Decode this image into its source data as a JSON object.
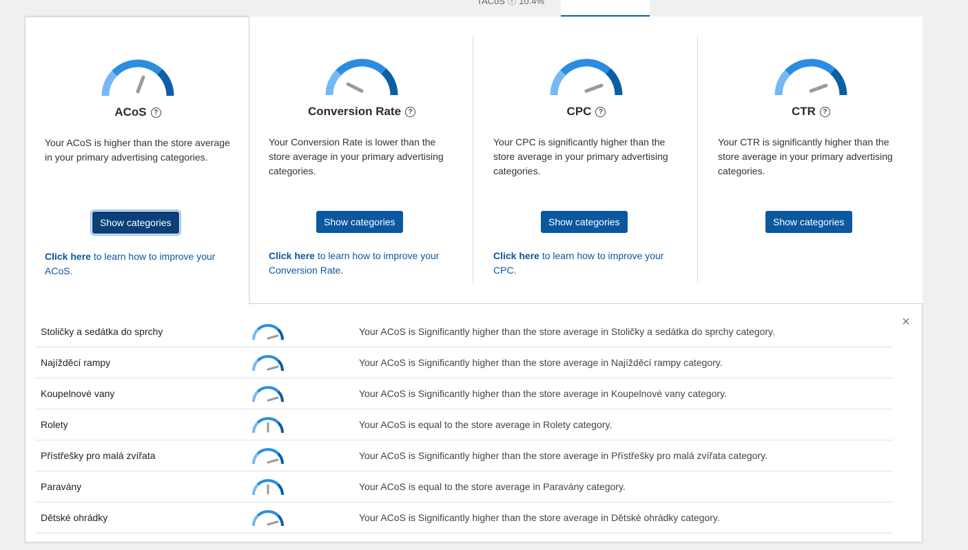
{
  "tabs": {
    "previous_label": "TACoS ⓘ 10.4%"
  },
  "metrics": [
    {
      "title": "ACoS",
      "description": "Your ACoS is higher than the store average in your primary advertising categories.",
      "button": "Show categories",
      "learn_bold": "Click here",
      "learn_rest": " to learn how to improve your ACoS."
    },
    {
      "title": "Conversion Rate",
      "description": "Your Conversion Rate is lower than the store average in your primary advertising categories.",
      "button": "Show categories",
      "learn_bold": "Click here",
      "learn_rest": " to learn how to improve your Conversion Rate."
    },
    {
      "title": "CPC",
      "description": "Your CPC is significantly higher than the store average in your primary advertising categories.",
      "button": "Show categories",
      "learn_bold": "Click here",
      "learn_rest": " to learn how to improve your CPC."
    },
    {
      "title": "CTR",
      "description": "Your CTR is significantly higher than the store average in your primary advertising categories.",
      "button": "Show categories"
    }
  ],
  "categories": {
    "close_label": "×",
    "rows": [
      {
        "name": "Stoličky a sedátka do sprchy",
        "message": "Your ACoS is Significantly higher than the store average in Stoličky a sedátka do sprchy category."
      },
      {
        "name": "Najížděcí rampy",
        "message": "Your ACoS is Significantly higher than the store average in Najížděcí rampy category."
      },
      {
        "name": "Koupelnové vany",
        "message": "Your ACoS is Significantly higher than the store average in Koupelnové vany category."
      },
      {
        "name": "Rolety",
        "message": "Your ACoS is equal to the store average in Rolety category."
      },
      {
        "name": "Přístřešky pro malá zvířata",
        "message": "Your ACoS is Significantly higher than the store average in Přístřešky pro malá zvířata category."
      },
      {
        "name": "Paravány",
        "message": "Your ACoS is equal to the store average in Paravány category."
      },
      {
        "name": "Dětské ohrádky",
        "message": "Your ACoS is Significantly higher than the store average in Dětské ohrádky category."
      }
    ]
  },
  "colors": {
    "gauge_light": "#74b9f5",
    "gauge_mid": "#2b8de0",
    "gauge_dark": "#0b5fa5",
    "needle": "#9a9a9a",
    "button": "#0b57a0"
  }
}
